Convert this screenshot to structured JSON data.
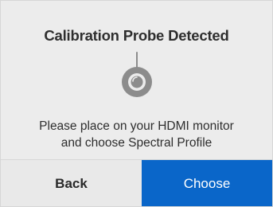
{
  "dialog": {
    "title": "Calibration Probe Detected",
    "icon": "calibration-probe-icon",
    "message_lines": [
      "Please place on your HDMI monitor",
      "and choose Spectral Profile"
    ]
  },
  "buttons": {
    "back_label": "Back",
    "choose_label": "Choose"
  },
  "colors": {
    "background": "#ececec",
    "accent": "#0a66c9",
    "text": "#2e2e2e",
    "icon": "#8c8c8c"
  }
}
